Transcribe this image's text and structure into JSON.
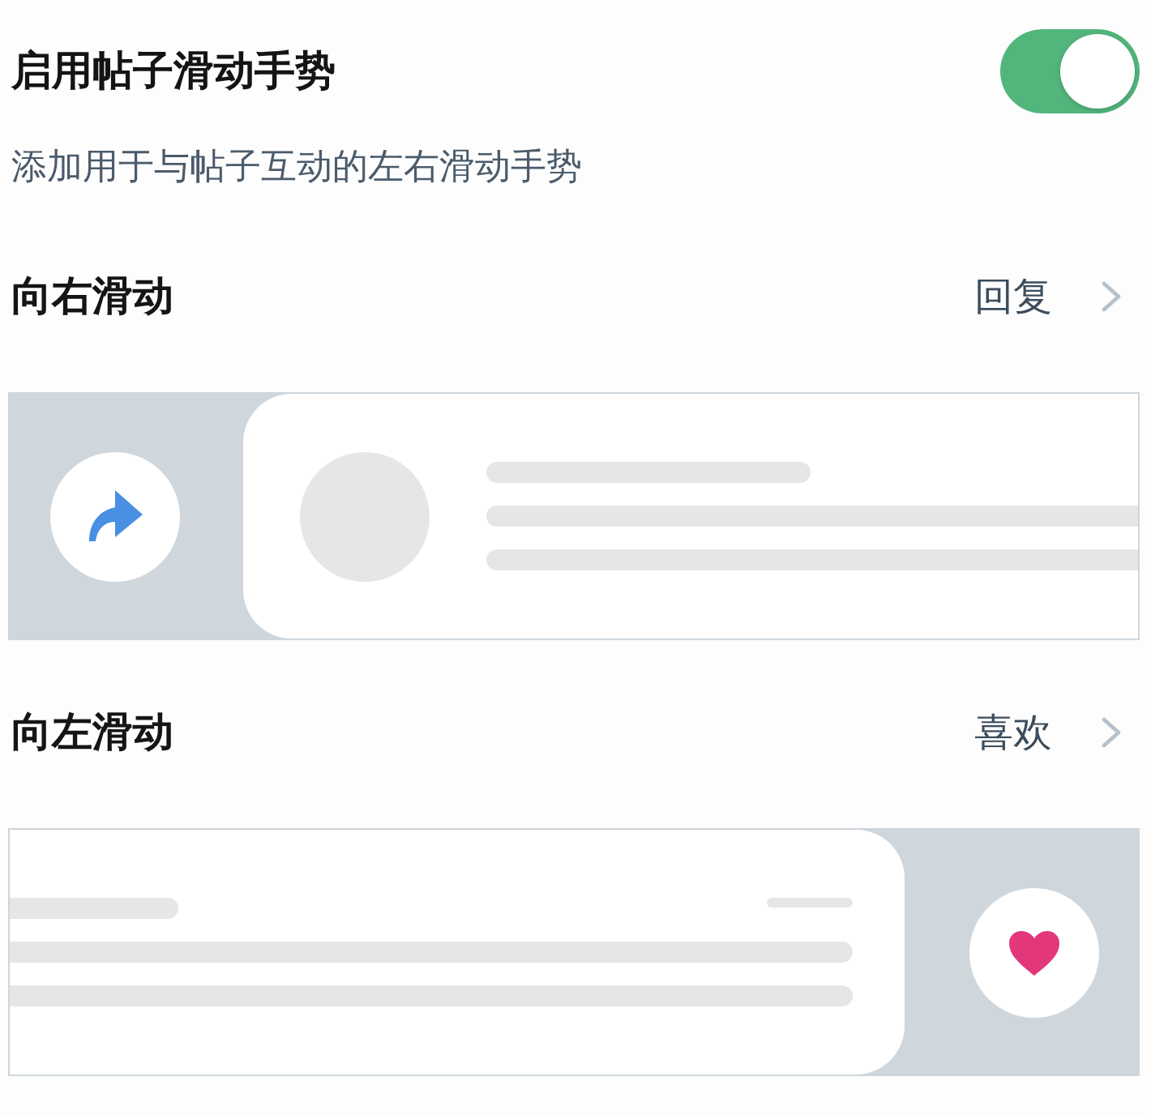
{
  "setting": {
    "title": "启用帖子滑动手势",
    "on": true,
    "description": "添加用于与帖子互动的左右滑动手势"
  },
  "gestures": [
    {
      "kind": "right",
      "label": "向右滑动",
      "action": "回复"
    },
    {
      "kind": "left",
      "label": "向左滑动",
      "action": "喜欢"
    }
  ]
}
